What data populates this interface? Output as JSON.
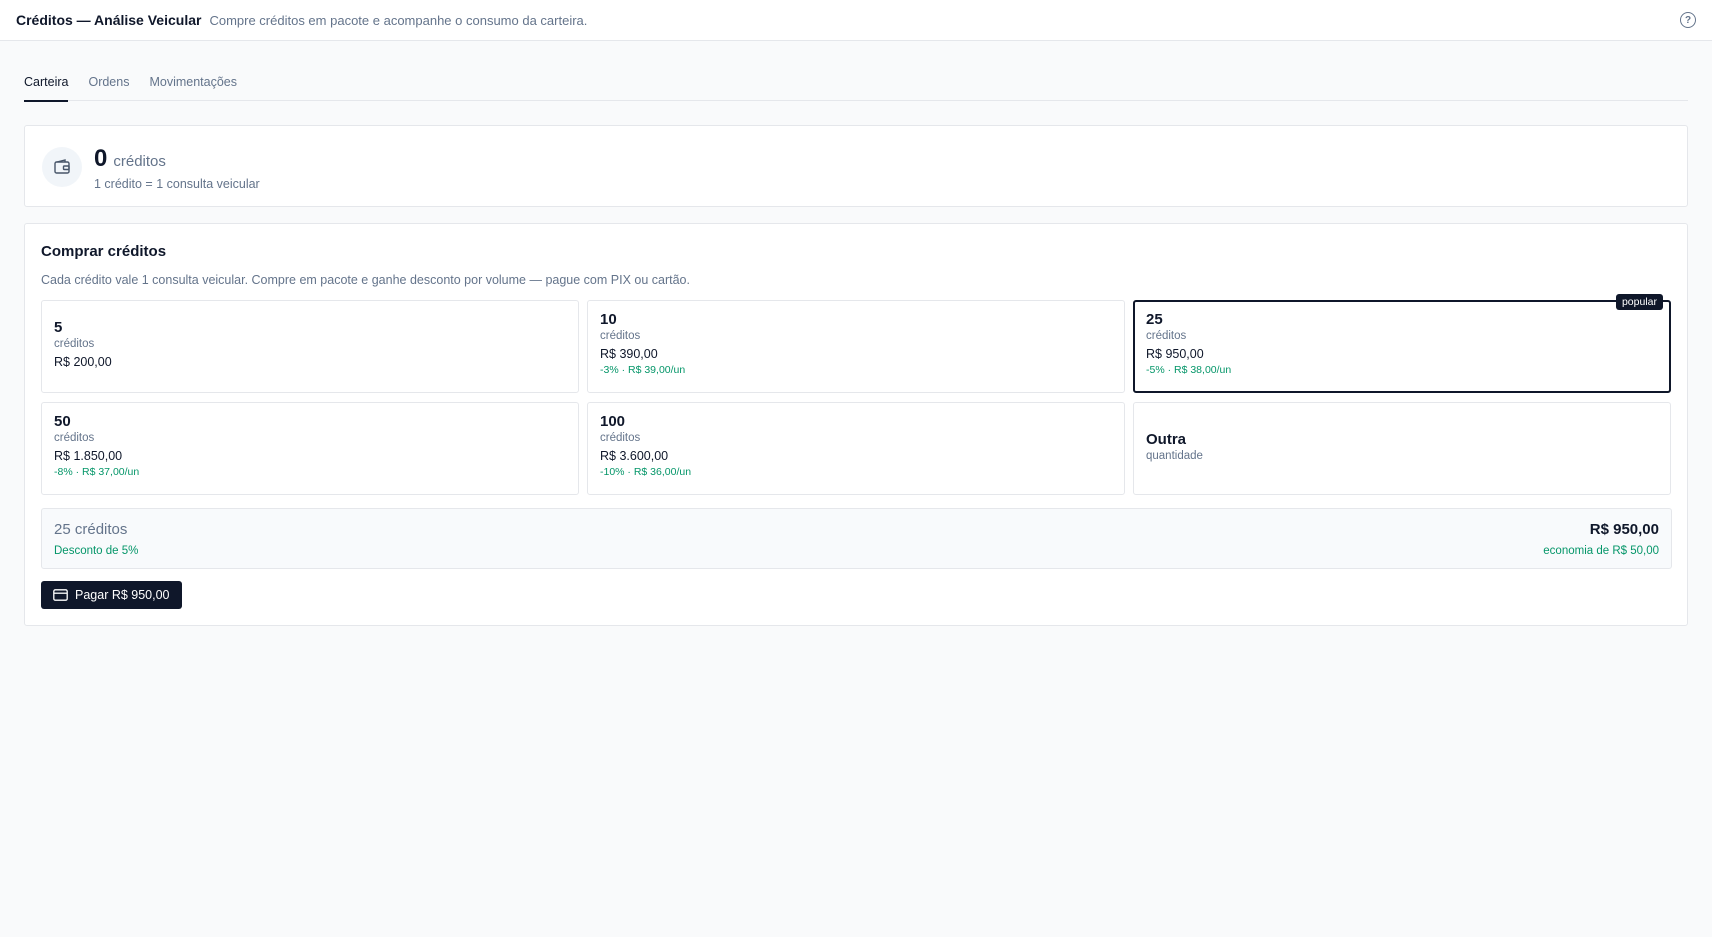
{
  "header": {
    "title": "Créditos — Análise Veicular",
    "subtitle": "Compre créditos em pacote e acompanhe o consumo da carteira.",
    "help_icon": "help-circle-icon",
    "help_glyph": "?"
  },
  "tabs": [
    {
      "label": "Carteira",
      "active": true
    },
    {
      "label": "Ordens",
      "active": false
    },
    {
      "label": "Movimentações",
      "active": false
    }
  ],
  "wallet": {
    "icon": "wallet-icon",
    "balance": "0",
    "unit": "créditos",
    "rate": "1 crédito = 1 consulta veicular"
  },
  "buy": {
    "title": "Comprar créditos",
    "description": "Cada crédito vale 1 consulta veicular. Compre em pacote e ganhe desconto por volume — pague com PIX ou cartão.",
    "packages": [
      {
        "quantity": "5",
        "unit": "créditos",
        "price": "R$ 200,00",
        "discount": ""
      },
      {
        "quantity": "10",
        "unit": "créditos",
        "price": "R$ 390,00",
        "discount": "-3% · R$ 39,00/un"
      },
      {
        "quantity": "25",
        "unit": "créditos",
        "price": "R$ 950,00",
        "discount": "-5% · R$ 38,00/un",
        "badge": "popular",
        "selected": true
      },
      {
        "quantity": "50",
        "unit": "créditos",
        "price": "R$ 1.850,00",
        "discount": "-8% · R$ 37,00/un"
      },
      {
        "quantity": "100",
        "unit": "créditos",
        "price": "R$ 3.600,00",
        "discount": "-10% · R$ 36,00/un"
      }
    ],
    "custom": {
      "label": "Outra",
      "sub": "quantidade"
    },
    "summary": {
      "quantity": "25 créditos",
      "discount": "Desconto de 5%",
      "total": "R$ 950,00",
      "savings": "economia de R$ 50,00"
    },
    "pay_button": {
      "label": "Pagar R$ 950,00",
      "icon": "credit-card-icon"
    }
  },
  "colors": {
    "accent": "#0f172a",
    "muted": "#64748b",
    "success": "#059669",
    "border": "#e5e7eb",
    "background": "#f9fafb"
  }
}
